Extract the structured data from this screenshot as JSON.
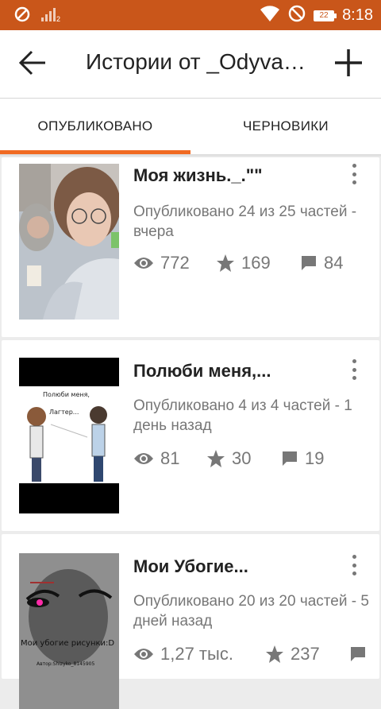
{
  "status_bar": {
    "time": "8:18",
    "battery": "22",
    "icons": [
      "no-sim-icon",
      "signal-icon",
      "wifi-icon",
      "dnd-icon",
      "battery-icon"
    ]
  },
  "app_bar": {
    "title": "Истории от _Odyvanc...",
    "back_icon": "arrow-back-icon",
    "add_icon": "plus-icon"
  },
  "tabs": [
    {
      "label": "ОПУБЛИКОВАНО",
      "active": true
    },
    {
      "label": "ЧЕРНОВИКИ",
      "active": false
    }
  ],
  "stories": [
    {
      "title": "Моя жизнь._.\"\"",
      "meta": "Опубликовано 24 из 25 частей - вчера",
      "views": "772",
      "votes": "169",
      "comments": "84"
    },
    {
      "title": "Полюби меня,...",
      "meta": "Опубликовано 4 из 4 частей - 1 день назад",
      "views": "81",
      "votes": "30",
      "comments": "19",
      "cover_text_1": "Полюби меня,",
      "cover_text_2": "Лагтер..."
    },
    {
      "title": "Мои Убогие...",
      "meta": "Опубликовано 20 из 20 частей - 5 дней назад",
      "views": "1,27 тыс.",
      "votes": "237",
      "comments": "",
      "cover_text_1": "Мои убогие рисунки:D",
      "cover_text_2": "Автор:Shizyko_8145905"
    }
  ],
  "colors": {
    "status_bar": "#c9561a",
    "accent": "#f06a22",
    "meta_text": "#777777"
  }
}
